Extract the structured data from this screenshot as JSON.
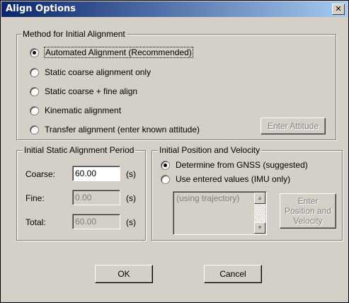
{
  "window": {
    "title": "Align Options",
    "close_glyph": "✕"
  },
  "method": {
    "legend": "Method for Initial Alignment",
    "options": [
      {
        "label": "Automated Alignment  (Recommended)",
        "selected": true
      },
      {
        "label": "Static coarse alignment only",
        "selected": false
      },
      {
        "label": "Static coarse + fine align",
        "selected": false
      },
      {
        "label": "Kinematic alignment",
        "selected": false
      },
      {
        "label": "Transfer alignment (enter known attitude)",
        "selected": false
      }
    ],
    "enter_attitude_label": "Enter Attitude"
  },
  "period": {
    "legend": "Initial Static Alignment Period",
    "rows": [
      {
        "label": "Coarse:",
        "value": "60.00",
        "unit": "(s)",
        "enabled": true
      },
      {
        "label": "Fine:",
        "value": "0.00",
        "unit": "(s)",
        "enabled": false
      },
      {
        "label": "Total:",
        "value": "60.00",
        "unit": "(s)",
        "enabled": false
      }
    ]
  },
  "position": {
    "legend": "Initial Position and Velocity",
    "options": [
      {
        "label": "Determine from GNSS (suggested)",
        "selected": true
      },
      {
        "label": "Use entered values (IMU only)",
        "selected": false
      }
    ],
    "list_text": "(using trajectory)",
    "enter_button_label": "Enter Position and Velocity",
    "scroll_up_icon": "triangle-up",
    "scroll_down_icon": "triangle-down"
  },
  "buttons": {
    "ok": "OK",
    "cancel": "Cancel"
  }
}
